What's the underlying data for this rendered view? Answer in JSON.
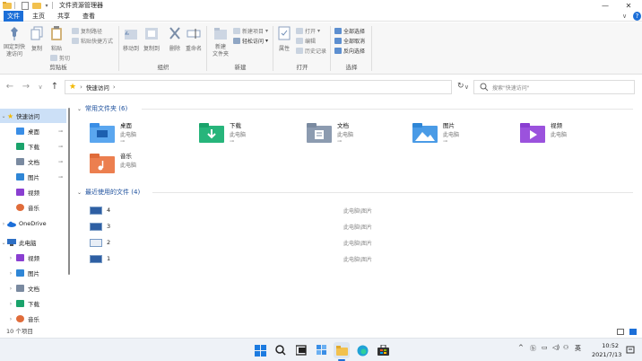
{
  "titlebar": {
    "title": "文件资源管理器",
    "minimize_glyph": "—",
    "maximize_glyph": "☐",
    "close_glyph": "✕"
  },
  "tabs": [
    {
      "label": "文件",
      "active": true
    },
    {
      "label": "主页",
      "active": false
    },
    {
      "label": "共享",
      "active": false
    },
    {
      "label": "查看",
      "active": false
    }
  ],
  "ribbon": {
    "clipboard": {
      "pin_label": "固定到快\n速访问",
      "copy_label": "复制",
      "paste_label": "粘贴",
      "copy_path_label": "复制路径",
      "paste_shortcut_label": "粘贴快捷方式",
      "cut_label": "剪切",
      "group_label": "剪贴板"
    },
    "organize": {
      "move_to_label": "移动到",
      "copy_to_label": "复制到",
      "delete_label": "删除",
      "rename_label": "重命名",
      "group_label": "组织"
    },
    "new": {
      "new_folder_label": "新建\n文件夹",
      "new_item_label": "新建项目",
      "easy_access_label": "轻松访问",
      "group_label": "新建"
    },
    "open": {
      "properties_label": "属性",
      "open_label": "打开",
      "edit_label": "编辑",
      "history_label": "历史记录",
      "group_label": "打开"
    },
    "select": {
      "select_all_label": "全部选择",
      "select_none_label": "全部取消",
      "invert_label": "反向选择",
      "group_label": "选择"
    }
  },
  "nav": {
    "back": "←",
    "forward": "→",
    "recent": "∨",
    "up": "↑",
    "breadcrumb_current": "快速访问",
    "breadcrumb_sep": "›",
    "dropdown": "∨",
    "refresh": "↻",
    "search_placeholder": "搜索\"快速访问\""
  },
  "sidebar": {
    "quick_access": "快速访问",
    "quick_items": [
      {
        "label": "桌面",
        "color": "#3a8ee6",
        "pinned": true
      },
      {
        "label": "下载",
        "color": "#1aa36b",
        "pinned": true
      },
      {
        "label": "文档",
        "color": "#7a8aa0",
        "pinned": true
      },
      {
        "label": "图片",
        "color": "#2f86d6",
        "pinned": true
      },
      {
        "label": "视频",
        "color": "#8a3fd1",
        "pinned": false
      },
      {
        "label": "音乐",
        "color": "#e06c3a",
        "pinned": false
      }
    ],
    "onedrive": "OneDrive",
    "this_pc": "此电脑",
    "pc_items": [
      {
        "label": "视频",
        "color": "#8a3fd1"
      },
      {
        "label": "图片",
        "color": "#2f86d6"
      },
      {
        "label": "文档",
        "color": "#7a8aa0"
      },
      {
        "label": "下载",
        "color": "#1aa36b"
      },
      {
        "label": "音乐",
        "color": "#e06c3a"
      }
    ],
    "pin_glyph": "📌"
  },
  "main": {
    "frequent_header": "常用文件夹 (6)",
    "folders": [
      {
        "name": "桌面",
        "sub": "此电脑",
        "pinned": true,
        "color": "#3a8ee6"
      },
      {
        "name": "下载",
        "sub": "此电脑",
        "pinned": true,
        "color": "#1aa36b"
      },
      {
        "name": "文档",
        "sub": "此电脑",
        "pinned": true,
        "color": "#7a8aa0"
      },
      {
        "name": "图片",
        "sub": "此电脑",
        "pinned": true,
        "color": "#2f86d6"
      },
      {
        "name": "视频",
        "sub": "此电脑",
        "pinned": false,
        "color": "#8a3fd1"
      },
      {
        "name": "音乐",
        "sub": "此电脑",
        "pinned": false,
        "color": "#e06c3a"
      }
    ],
    "recent_header": "最近使用的文件 (4)",
    "recent": [
      {
        "name": "4",
        "path": "此电脑\\图片"
      },
      {
        "name": "3",
        "path": "此电脑\\图片"
      },
      {
        "name": "2",
        "path": "此电脑\\图片"
      },
      {
        "name": "1",
        "path": "此电脑\\图片"
      }
    ]
  },
  "status": {
    "count": "10 个项目"
  },
  "taskbar": {
    "tray_expand": "^",
    "ime": "英",
    "time": "10:52",
    "date": "2021/7/13"
  },
  "colors": {
    "accent": "#1c6fd8",
    "selection": "#cce0f7"
  }
}
